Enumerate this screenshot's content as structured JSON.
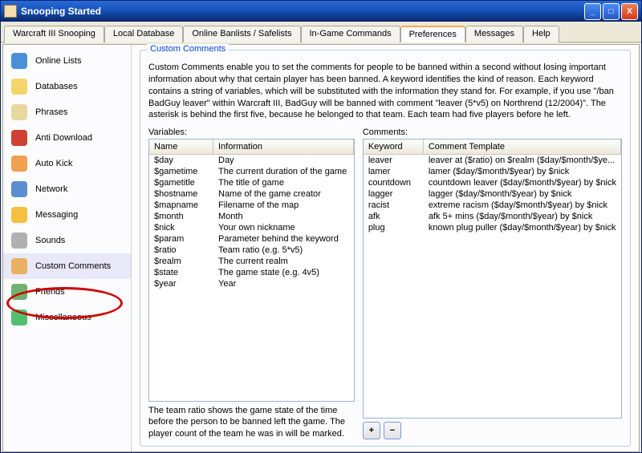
{
  "window": {
    "title": "Snooping Started"
  },
  "tabs": [
    "Warcraft III Snooping",
    "Local Database",
    "Online Banlists / Safelists",
    "In-Game Commands",
    "Preferences",
    "Messages",
    "Help"
  ],
  "active_tab": 4,
  "sidebar": {
    "items": [
      {
        "label": "Online Lists",
        "icon": "globe-icon"
      },
      {
        "label": "Databases",
        "icon": "database-icon"
      },
      {
        "label": "Phrases",
        "icon": "scroll-icon"
      },
      {
        "label": "Anti Download",
        "icon": "blocked-icon"
      },
      {
        "label": "Auto Kick",
        "icon": "people-icon"
      },
      {
        "label": "Network",
        "icon": "network-icon"
      },
      {
        "label": "Messaging",
        "icon": "chat-icon"
      },
      {
        "label": "Sounds",
        "icon": "speaker-icon"
      },
      {
        "label": "Custom Comments",
        "icon": "users-icon"
      },
      {
        "label": "Friends",
        "icon": "friends-icon"
      },
      {
        "label": "Miscellaneous",
        "icon": "check-icon"
      }
    ],
    "selected": 8
  },
  "main": {
    "group_title": "Custom Comments",
    "description": "Custom Comments enable you to set the comments for people to be banned within a second without losing important information about why that certain player has been banned. A keyword identifies the kind of reason. Each keyword contains a string of variables, which will be substituted with the information they stand for. For example, if you use \"/ban BadGuy leaver\" within Warcraft III, BadGuy will be banned with comment \"leaver (5*v5) on Northrend (12/2004)\". The asterisk is behind the first five, because he belonged to that team. Each team had five players before he left.",
    "variables_label": "Variables:",
    "variables_head": [
      "Name",
      "Information"
    ],
    "variables": [
      {
        "name": "$day",
        "info": "Day"
      },
      {
        "name": "$gametime",
        "info": "The current duration of the game"
      },
      {
        "name": "$gametitle",
        "info": "The title of game"
      },
      {
        "name": "$hostname",
        "info": "Name of the game creator"
      },
      {
        "name": "$mapname",
        "info": "Filename of the map"
      },
      {
        "name": "$month",
        "info": "Month"
      },
      {
        "name": "$nick",
        "info": "Your own nickname"
      },
      {
        "name": "$param",
        "info": "Parameter behind the keyword"
      },
      {
        "name": "$ratio",
        "info": "Team ratio (e.g. 5*v5)"
      },
      {
        "name": "$realm",
        "info": "The current realm"
      },
      {
        "name": "$state",
        "info": "The game state (e.g. 4v5)"
      },
      {
        "name": "$year",
        "info": "Year"
      }
    ],
    "variables_footnote": "The team ratio shows the game state of the time before the person to be banned left the game. The player count of the team he was in will be marked.",
    "comments_label": "Comments:",
    "comments_head": [
      "Keyword",
      "Comment Template"
    ],
    "comments": [
      {
        "keyword": "leaver",
        "template": "leaver at ($ratio) on $realm ($day/$month/$ye..."
      },
      {
        "keyword": "lamer",
        "template": "lamer ($day/$month/$year) by $nick"
      },
      {
        "keyword": "countdown",
        "template": "countdown leaver ($day/$month/$year) by $nick"
      },
      {
        "keyword": "lagger",
        "template": "lagger ($day/$month/$year) by $nick"
      },
      {
        "keyword": "racist",
        "template": "extreme racism ($day/$month/$year) by $nick"
      },
      {
        "keyword": "afk",
        "template": "afk 5+ mins ($day/$month/$year) by $nick"
      },
      {
        "keyword": "plug",
        "template": "known plug puller ($day/$month/$year) by $nick"
      }
    ],
    "add_label": "+",
    "remove_label": "−"
  }
}
